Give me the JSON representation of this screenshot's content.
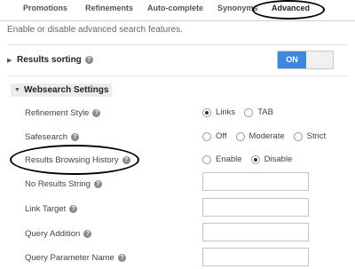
{
  "tabs": [
    {
      "label": "Promotions",
      "active": false
    },
    {
      "label": "Refinements",
      "active": false
    },
    {
      "label": "Auto-complete",
      "active": false
    },
    {
      "label": "Synonyms",
      "active": false
    },
    {
      "label": "Advanced",
      "active": true
    }
  ],
  "description": "Enable or disable advanced search features.",
  "results_sorting": {
    "title": "Results sorting",
    "toggle_on_label": "ON",
    "enabled": true
  },
  "websearch_settings": {
    "title": "Websearch Settings",
    "refinement_style": {
      "label": "Refinement Style",
      "options": [
        "Links",
        "TAB"
      ],
      "selected": "Links"
    },
    "safesearch": {
      "label": "Safesearch",
      "options": [
        "Off",
        "Moderate",
        "Strict"
      ],
      "selected": null
    },
    "results_browsing_history": {
      "label": "Results Browsing History",
      "options": [
        "Enable",
        "Disable"
      ],
      "selected": "Disable"
    },
    "no_results_string": {
      "label": "No Results String",
      "value": ""
    },
    "link_target": {
      "label": "Link Target",
      "value": ""
    },
    "query_addition": {
      "label": "Query Addition",
      "value": ""
    },
    "query_parameter_name": {
      "label": "Query Parameter Name",
      "value": ""
    }
  },
  "icons": {
    "help": "question-mark-icon",
    "collapsed": "triangle-right-icon",
    "expanded": "triangle-down-icon"
  },
  "colors": {
    "toggle_on": "#3d87e0",
    "section_bg": "#ececec"
  }
}
